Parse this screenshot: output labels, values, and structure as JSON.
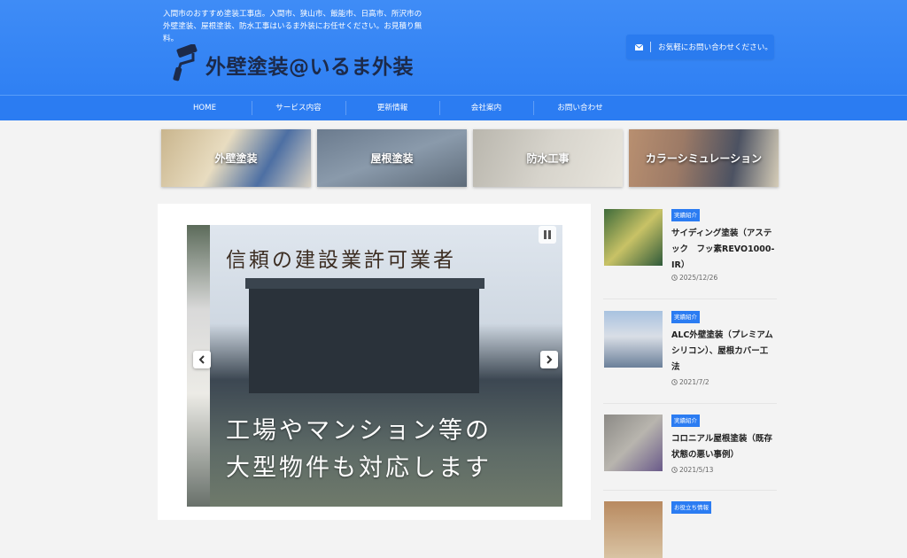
{
  "header": {
    "tagline": "入間市のおすすめ塗装工事店。入間市、狭山市、飯能市、日高市、所沢市の外壁塗装、屋根塗装、防水工事はいるま外装にお任せください。お見積り無料。",
    "logo_text": "外壁塗装@いるま外装",
    "contact_label": "お気軽にお問い合わせください。"
  },
  "nav": {
    "items": [
      "HOME",
      "サービス内容",
      "更新情報",
      "会社案内",
      "お問い合わせ"
    ]
  },
  "tiles": [
    {
      "label": "外壁塗装"
    },
    {
      "label": "屋根塗装"
    },
    {
      "label": "防水工事"
    },
    {
      "label": "カラーシミュレーション"
    }
  ],
  "slider": {
    "title": "信頼の建設業許可業者",
    "subtitle_line1": "工場やマンション等の",
    "subtitle_line2": "大型物件も対応します"
  },
  "sidebar": {
    "posts": [
      {
        "category": "実績紹介",
        "title": "サイディング塗装（アステック　フッ素REVO1000-IR）",
        "date": "2025/12/26"
      },
      {
        "category": "実績紹介",
        "title": "ALC外壁塗装（プレミアムシリコン）、屋根カバー工法",
        "date": "2021/7/2"
      },
      {
        "category": "実績紹介",
        "title": "コロニアル屋根塗装（既存状態の悪い事例）",
        "date": "2021/5/13"
      },
      {
        "category": "お役立ち情報",
        "title": "",
        "date": ""
      }
    ]
  },
  "colors": {
    "header_bg": "#3f8cf6",
    "nav_bg": "#2b7cf2",
    "badge_bg": "#2b7cf2"
  }
}
